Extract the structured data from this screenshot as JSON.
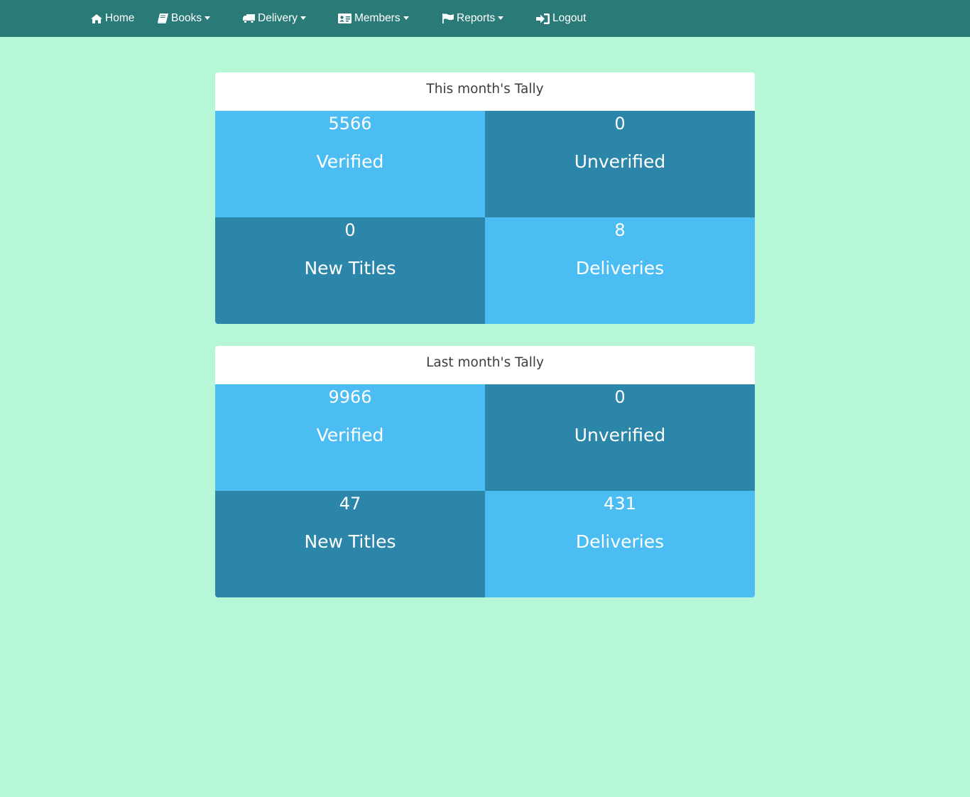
{
  "nav": {
    "home": {
      "label": "Home",
      "icon": "home-icon"
    },
    "books": {
      "label": "Books",
      "icon": "book-icon"
    },
    "delivery": {
      "label": "Delivery",
      "icon": "truck-icon"
    },
    "members": {
      "label": "Members",
      "icon": "id-card-icon"
    },
    "reports": {
      "label": "Reports",
      "icon": "flag-icon"
    },
    "logout": {
      "label": "Logout",
      "icon": "sign-in-icon"
    }
  },
  "this_month": {
    "title": "This month's Tally",
    "verified": {
      "count": "5566",
      "label": "Verified"
    },
    "unverified": {
      "count": "0",
      "label": "Unverified"
    },
    "new_titles": {
      "count": "0",
      "label": "New Titles"
    },
    "deliveries": {
      "count": "8",
      "label": "Deliveries"
    }
  },
  "last_month": {
    "title": "Last month's Tally",
    "verified": {
      "count": "9966",
      "label": "Verified"
    },
    "unverified": {
      "count": "0",
      "label": "Unverified"
    },
    "new_titles": {
      "count": "47",
      "label": "New Titles"
    },
    "deliveries": {
      "count": "431",
      "label": "Deliveries"
    }
  },
  "colors": {
    "background": "#b6f7d8",
    "navbar": "#2a7b77",
    "tile_light": "#4bbdf2",
    "tile_dark": "#2c86aa"
  }
}
